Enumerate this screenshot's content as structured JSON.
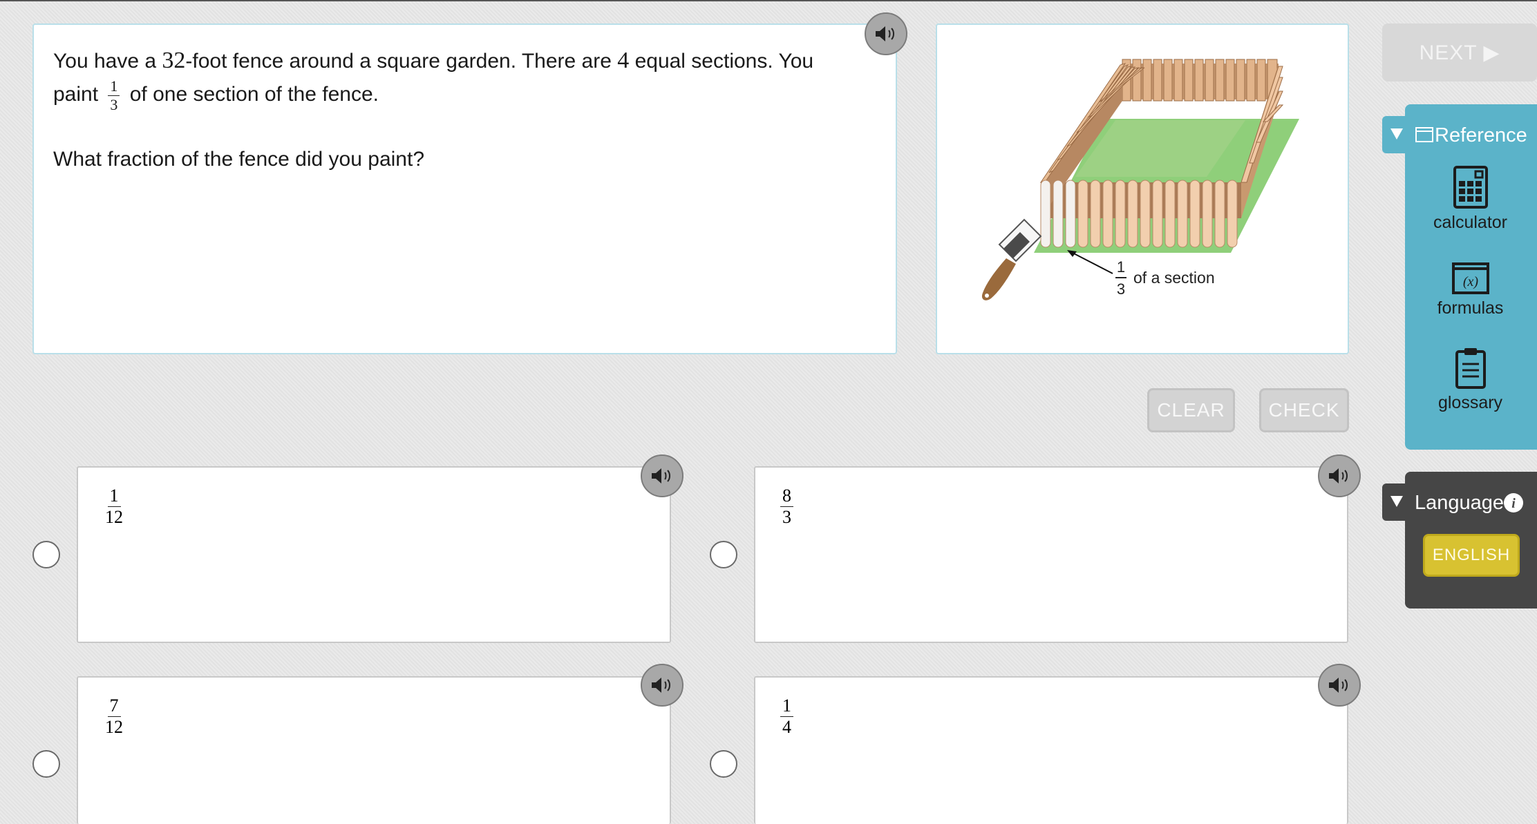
{
  "question": {
    "line1_a": "You have a ",
    "fence_length": "32",
    "line1_b": "-foot fence around a square garden. There are ",
    "sections": "4",
    "line1_c": " equal sections. You",
    "line2_a": "paint ",
    "paint_numerator": "1",
    "paint_denominator": "3",
    "line2_b": " of one section of the fence.",
    "prompt": "What fraction of the fence did you paint?"
  },
  "figure": {
    "label_numerator": "1",
    "label_denominator": "3",
    "label_text": "of a section",
    "colors": {
      "garden": "#8fcf7a",
      "fence": "#f2cfae",
      "painted": "#f5f5f5",
      "brush_handle": "#9a6a3c"
    }
  },
  "buttons": {
    "clear": "CLEAR",
    "check": "CHECK",
    "next": "NEXT ▶"
  },
  "choices": [
    {
      "numerator": "1",
      "denominator": "12"
    },
    {
      "numerator": "8",
      "denominator": "3"
    },
    {
      "numerator": "7",
      "denominator": "12"
    },
    {
      "numerator": "1",
      "denominator": "4"
    }
  ],
  "reference": {
    "title": "Reference",
    "tools": [
      "calculator",
      "formulas",
      "glossary"
    ],
    "color": "#5bb3c9"
  },
  "language": {
    "title": "Language",
    "current": "ENGLISH",
    "color": "#464646",
    "button_color": "#d8c231"
  },
  "icons": [
    "speaker-icon",
    "calculator-icon",
    "formulas-icon",
    "glossary-icon",
    "info-icon",
    "triangle-down-icon",
    "reference-window-icon"
  ]
}
